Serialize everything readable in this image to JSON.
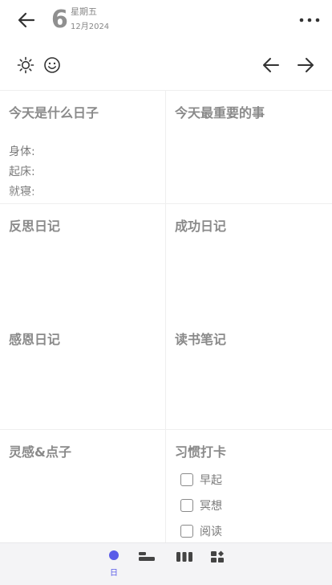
{
  "header": {
    "day": "6",
    "weekday": "星期五",
    "month_year": "12月2024"
  },
  "toolbar": {
    "left_icons": [
      "brightness-icon",
      "smiley-icon"
    ],
    "right_icons": [
      "arrow-left-icon",
      "arrow-right-icon"
    ]
  },
  "sections": {
    "today": {
      "title": "今天是什么日子",
      "fields": [
        "身体:",
        "起床:",
        "就寝:"
      ]
    },
    "important": {
      "title": "今天最重要的事"
    },
    "reflection": {
      "title": "反思日记"
    },
    "success": {
      "title": "成功日记"
    },
    "gratitude": {
      "title": "感恩日记"
    },
    "reading": {
      "title": "读书笔记"
    },
    "ideas": {
      "title": "灵感&点子"
    },
    "habits": {
      "title": "习惯打卡",
      "items": [
        {
          "label": "早起",
          "checked": false
        },
        {
          "label": "冥想",
          "checked": false
        },
        {
          "label": "阅读",
          "checked": false
        }
      ]
    }
  },
  "bottom_nav": {
    "active_color": "#5a5ce8",
    "items": [
      {
        "icon": "dot-icon",
        "label": "日",
        "active": true
      },
      {
        "icon": "week-bars-icon",
        "label": "",
        "active": false
      },
      {
        "icon": "month-columns-icon",
        "label": "",
        "active": false
      },
      {
        "icon": "widgets-icon",
        "label": "",
        "active": false
      }
    ]
  }
}
